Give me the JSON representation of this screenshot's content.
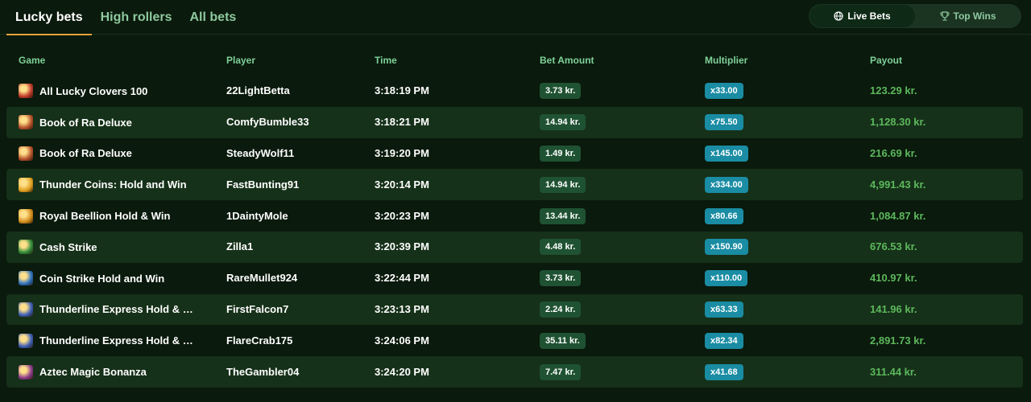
{
  "tabs": [
    {
      "label": "Lucky bets",
      "active": true
    },
    {
      "label": "High rollers",
      "active": false
    },
    {
      "label": "All bets",
      "active": false
    }
  ],
  "toggle": {
    "live_label": "Live Bets",
    "top_label": "Top Wins",
    "active": "live"
  },
  "columns": {
    "game": "Game",
    "player": "Player",
    "time": "Time",
    "bet": "Bet Amount",
    "multiplier": "Multiplier",
    "payout": "Payout"
  },
  "rows": [
    {
      "icon": "clover-slot-icon",
      "icon_color": "#c0392b",
      "game": "All Lucky Clovers 100",
      "player": "22LightBetta",
      "time": "3:18:19 PM",
      "bet": "3.73 kr.",
      "multiplier": "x33.00",
      "payout": "123.29 kr."
    },
    {
      "icon": "book-of-ra-icon",
      "icon_color": "#b5502a",
      "game": "Book of Ra Deluxe",
      "player": "ComfyBumble33",
      "time": "3:18:21 PM",
      "bet": "14.94 kr.",
      "multiplier": "x75.50",
      "payout": "1,128.30 kr."
    },
    {
      "icon": "book-of-ra-icon",
      "icon_color": "#b5502a",
      "game": "Book of Ra Deluxe",
      "player": "SteadyWolf11",
      "time": "3:19:20 PM",
      "bet": "1.49 kr.",
      "multiplier": "x145.00",
      "payout": "216.69 kr."
    },
    {
      "icon": "thunder-coins-icon",
      "icon_color": "#e0a020",
      "game": "Thunder Coins: Hold and Win",
      "player": "FastBunting91",
      "time": "3:20:14 PM",
      "bet": "14.94 kr.",
      "multiplier": "x334.00",
      "payout": "4,991.43 kr."
    },
    {
      "icon": "royal-beellion-icon",
      "icon_color": "#d08a1a",
      "game": "Royal Beellion Hold & Win",
      "player": "1DaintyMole",
      "time": "3:20:23 PM",
      "bet": "13.44 kr.",
      "multiplier": "x80.66",
      "payout": "1,084.87 kr."
    },
    {
      "icon": "cash-strike-icon",
      "icon_color": "#2e8b3a",
      "game": "Cash Strike",
      "player": "Zilla1",
      "time": "3:20:39 PM",
      "bet": "4.48 kr.",
      "multiplier": "x150.90",
      "payout": "676.53 kr."
    },
    {
      "icon": "coin-strike-icon",
      "icon_color": "#2a6fc0",
      "game": "Coin Strike Hold and Win",
      "player": "RareMullet924",
      "time": "3:22:44 PM",
      "bet": "3.73 kr.",
      "multiplier": "x110.00",
      "payout": "410.97 kr."
    },
    {
      "icon": "thunderline-express-icon",
      "icon_color": "#3b5cb5",
      "game": "Thunderline Express Hold & …",
      "player": "FirstFalcon7",
      "time": "3:23:13 PM",
      "bet": "2.24 kr.",
      "multiplier": "x63.33",
      "payout": "141.96 kr."
    },
    {
      "icon": "thunderline-express-icon",
      "icon_color": "#3b5cb5",
      "game": "Thunderline Express Hold & …",
      "player": "FlareCrab175",
      "time": "3:24:06 PM",
      "bet": "35.11 kr.",
      "multiplier": "x82.34",
      "payout": "2,891.73 kr."
    },
    {
      "icon": "aztec-magic-icon",
      "icon_color": "#8b3a8b",
      "game": "Aztec Magic Bonanza",
      "player": "TheGambler04",
      "time": "3:24:20 PM",
      "bet": "7.47 kr.",
      "multiplier": "x41.68",
      "payout": "311.44 kr."
    }
  ]
}
